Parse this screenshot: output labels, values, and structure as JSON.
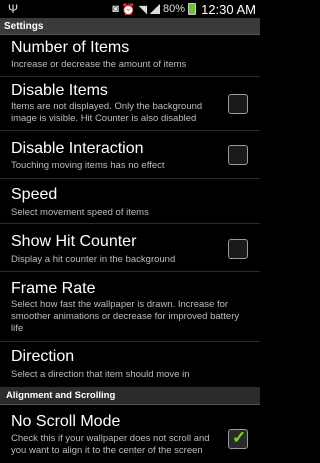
{
  "status_bar": {
    "usb_icon": "usb-icon",
    "battery_percent": "80%",
    "time": "12:30 AM"
  },
  "title_bar": {
    "title": "Settings"
  },
  "items": [
    {
      "title": "Number of Items",
      "summary": "Increase or decrease the amount of items"
    },
    {
      "title": "Disable Items",
      "summary": "Items are not displayed. Only the background image is visible. Hit Counter is also disabled",
      "checked": false
    },
    {
      "title": "Disable Interaction",
      "summary": "Touching moving items has no effect",
      "checked": false
    },
    {
      "title": "Speed",
      "summary": "Select movement speed of items"
    },
    {
      "title": "Show Hit Counter",
      "summary": "Display a hit counter in the background",
      "checked": false
    },
    {
      "title": "Frame Rate",
      "summary": "Select how fast the wallpaper is drawn. Increase for smoother animations or decrease for improved battery life"
    },
    {
      "title": "Direction",
      "summary": "Select a direction that item should move in"
    }
  ],
  "section_header": "Alignment and Scrolling",
  "section_items": [
    {
      "title": "No Scroll Mode",
      "summary": "Check this if your wallpaper does not scroll and you want to align it to the center of the screen",
      "checked": true
    }
  ],
  "colors": {
    "accent_check": "#7ed321",
    "title_bar_bg": "#3a3a3a"
  }
}
